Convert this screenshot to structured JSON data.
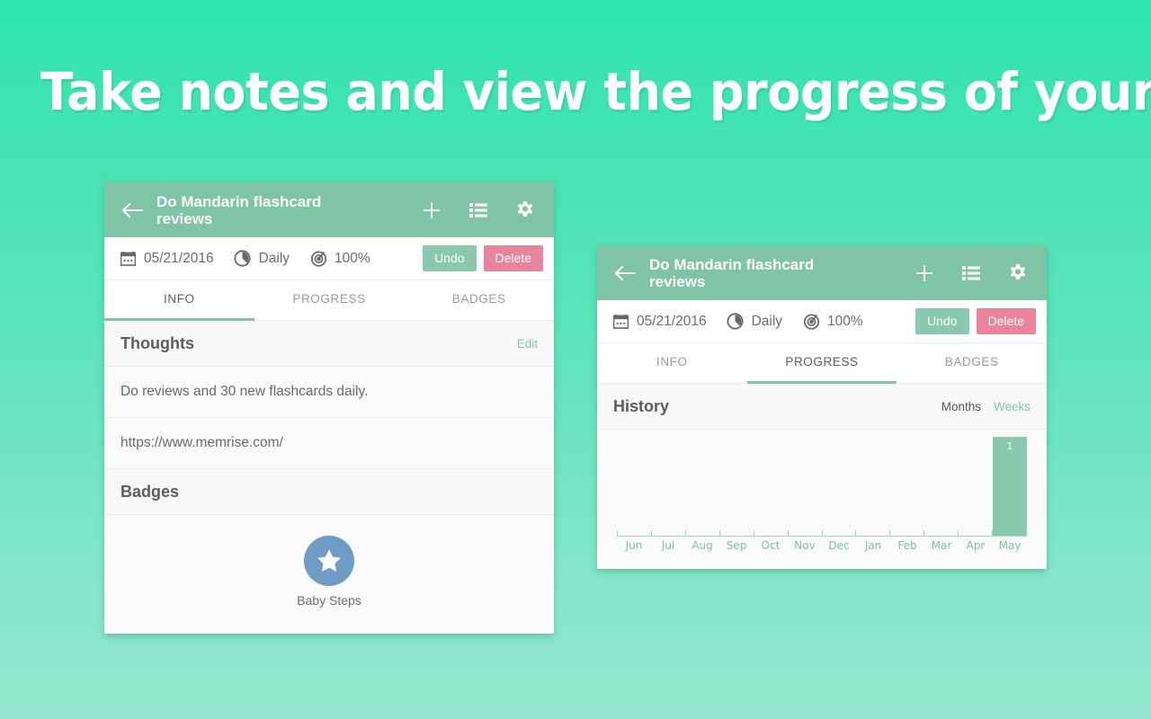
{
  "headline": "Take notes and view the progress of your habit",
  "colors": {
    "bg_top": "#2ee6ab",
    "bg_bottom": "#92e7cd",
    "appbar_green": "#7fc4a6",
    "accent_green": "#84c5a8",
    "bar_green": "#8ac9ad",
    "delete_pink": "#e8849c",
    "badge_blue": "#6e9cc4",
    "card_bg": "#fbfbfb"
  },
  "appbar": {
    "title": "Do Mandarin flashcard reviews",
    "back_icon": "arrow-left-icon",
    "actions": [
      {
        "name": "add-button",
        "icon": "plus-icon"
      },
      {
        "name": "list-button",
        "icon": "list-icon"
      },
      {
        "name": "settings-button",
        "icon": "gear-icon"
      }
    ]
  },
  "statbar": {
    "stats": [
      {
        "icon": "calendar-icon",
        "value": "05/21/2016"
      },
      {
        "icon": "clock-pie-icon",
        "value": "Daily"
      },
      {
        "icon": "target-icon",
        "value": "100%"
      }
    ],
    "undo_label": "Undo",
    "delete_label": "Delete"
  },
  "tabs": {
    "items": [
      "INFO",
      "PROGRESS",
      "BADGES"
    ],
    "active_left": "INFO",
    "active_right": "PROGRESS"
  },
  "info_tab": {
    "thoughts": {
      "title": "Thoughts",
      "edit_label": "Edit",
      "entries": [
        "Do reviews and 30 new flashcards daily.",
        "https://www.memrise.com/"
      ]
    },
    "badges": {
      "title": "Badges",
      "items": [
        {
          "name": "Baby Steps",
          "icon": "star-icon"
        }
      ]
    }
  },
  "progress_tab": {
    "history": {
      "title": "History",
      "range_months_label": "Months",
      "range_weeks_label": "Weeks",
      "selected_range": "Months"
    }
  },
  "chart_data": {
    "type": "bar",
    "title": "History",
    "categories": [
      "Jun",
      "Jul",
      "Aug",
      "Sep",
      "Oct",
      "Nov",
      "Dec",
      "Jan",
      "Feb",
      "Mar",
      "Apr",
      "May"
    ],
    "values": [
      0,
      0,
      0,
      0,
      0,
      0,
      0,
      0,
      0,
      0,
      0,
      1
    ],
    "value_labels": [
      "",
      "",
      "",
      "",
      "",
      "",
      "",
      "",
      "",
      "",
      "",
      "1"
    ],
    "xlabel": "",
    "ylabel": "",
    "ylim": [
      0,
      1
    ],
    "grid": false,
    "legend": false,
    "bar_color": "#8ac9ad",
    "tick_label_color": "#7ac3a2"
  }
}
